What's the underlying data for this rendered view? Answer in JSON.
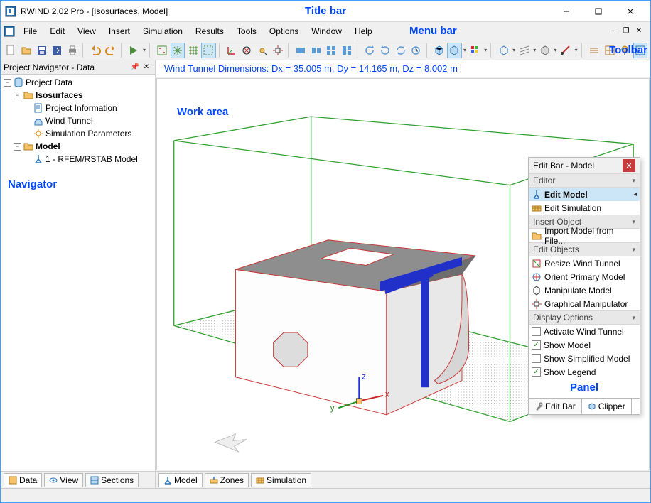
{
  "title": "RWIND 2.02 Pro - [Isosurfaces, Model]",
  "annotations": {
    "titlebar": "Title bar",
    "menubar": "Menu bar",
    "toolbar": "Toolbar",
    "navigator": "Navigator",
    "workarea": "Work area",
    "panel": "Panel"
  },
  "menu": [
    "File",
    "Edit",
    "View",
    "Insert",
    "Simulation",
    "Results",
    "Tools",
    "Options",
    "Window",
    "Help"
  ],
  "navigator": {
    "title": "Project Navigator - Data",
    "root": "Project Data",
    "group1": "Isosurfaces",
    "items1": [
      "Project Information",
      "Wind Tunnel",
      "Simulation Parameters"
    ],
    "group2": "Model",
    "items2": [
      "1 - RFEM/RSTAB Model"
    ],
    "tabs": [
      "Data",
      "View",
      "Sections"
    ]
  },
  "workarea": {
    "info": "Wind Tunnel Dimensions: Dx = 35.005 m, Dy = 14.165 m, Dz = 8.002 m",
    "tabs": [
      "Model",
      "Zones",
      "Simulation"
    ]
  },
  "panel": {
    "title": "Edit Bar - Model",
    "sections": {
      "editor": "Editor",
      "editor_items": [
        "Edit Model",
        "Edit Simulation"
      ],
      "insert": "Insert Object",
      "insert_items": [
        "Import Model from File..."
      ],
      "edit_objects": "Edit Objects",
      "edit_objects_items": [
        "Resize Wind Tunnel",
        "Orient Primary Model",
        "Manipulate Model",
        "Graphical Manipulator"
      ],
      "display": "Display Options",
      "display_items": [
        {
          "label": "Activate Wind Tunnel",
          "checked": false
        },
        {
          "label": "Show Model",
          "checked": true
        },
        {
          "label": "Show Simplified Model",
          "checked": false
        },
        {
          "label": "Show Legend",
          "checked": true
        }
      ]
    },
    "tabs": [
      "Edit Bar",
      "Clipper"
    ]
  }
}
